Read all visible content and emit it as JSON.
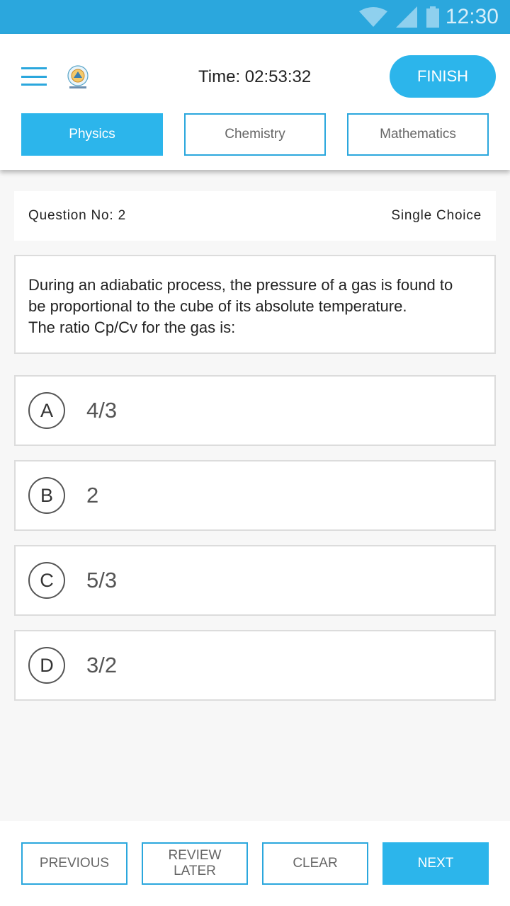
{
  "status_bar": {
    "time": "12:30",
    "icons": [
      "wifi-icon",
      "signal-icon",
      "battery-icon"
    ]
  },
  "header": {
    "timer": "Time: 02:53:32",
    "finish_label": "FINISH",
    "tabs": [
      {
        "label": "Physics",
        "active": true
      },
      {
        "label": "Chemistry",
        "active": false
      },
      {
        "label": "Mathematics",
        "active": false
      }
    ]
  },
  "question": {
    "number": "Question No: 2",
    "type": "Single Choice",
    "text_lines": [
      "During an adiabatic process, the pressure of a gas is found to",
      "be proportional to the cube of its absolute temperature.",
      "The ratio Cp/Cv for the gas is:"
    ]
  },
  "options": [
    {
      "letter": "A",
      "text": "4/3"
    },
    {
      "letter": "B",
      "text": "2"
    },
    {
      "letter": "C",
      "text": "5/3"
    },
    {
      "letter": "D",
      "text": "3/2"
    }
  ],
  "footer": {
    "previous": "PREVIOUS",
    "review_later": "REVIEW LATER",
    "clear": "CLEAR",
    "next": "NEXT"
  },
  "colors": {
    "accent": "#2cb5eb",
    "status_bar": "#2ba7dd",
    "border": "#dcdcdc"
  }
}
